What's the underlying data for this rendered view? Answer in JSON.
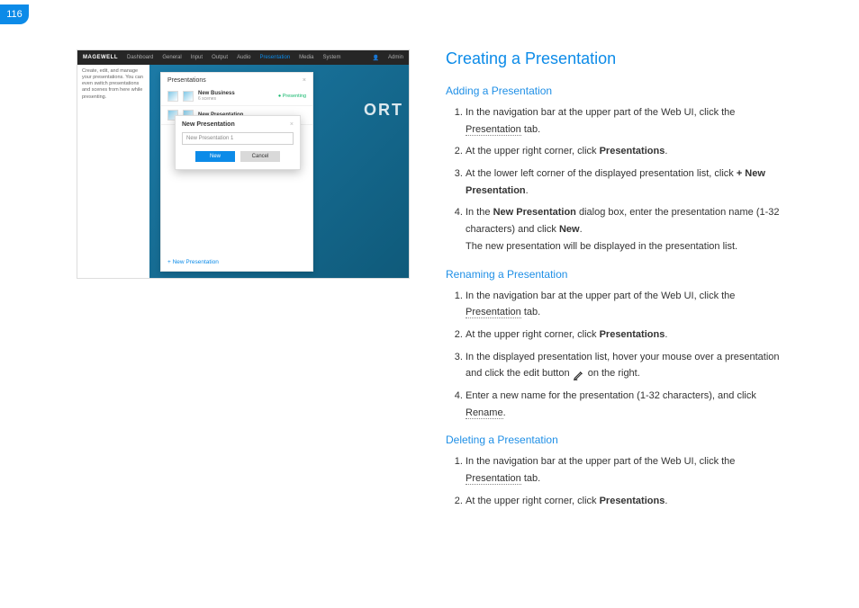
{
  "page_number": "116",
  "doc": {
    "title": "Creating a Presentation",
    "sections": [
      {
        "heading": "Adding a Presentation",
        "steps": [
          {
            "pre": "In the navigation bar at the upper part of the Web UI, click the ",
            "kw": "Presentation",
            "post": " tab."
          },
          {
            "pre": "At the upper right corner, click ",
            "bold": "Presentations",
            "post": "."
          },
          {
            "pre": "At the lower left corner of the displayed presentation list, click ",
            "bold": "+ New Presentation",
            "post": "."
          },
          {
            "pre": "In the ",
            "bold": "New Presentation",
            "mid": " dialog box, enter the presentation name (1-32 characters) and click ",
            "bold2": "New",
            "post": ".",
            "note": "The new presentation will be displayed in the presentation list."
          }
        ]
      },
      {
        "heading": "Renaming a Presentation",
        "steps": [
          {
            "pre": "In the navigation bar at the upper part of the Web UI, click the ",
            "kw": "Presentation",
            "post": " tab."
          },
          {
            "pre": "At the upper right corner, click ",
            "bold": "Presentations",
            "post": "."
          },
          {
            "pre": "In the displayed presentation list, hover your mouse over a presentation and click the edit button ",
            "icon": "pencil",
            "post": " on the right."
          },
          {
            "pre": "Enter a new name for the presentation (1-32 characters), and click ",
            "kw": "Rename",
            "post": "."
          }
        ]
      },
      {
        "heading": "Deleting a Presentation",
        "steps": [
          {
            "pre": "In the navigation bar at the upper part of the Web UI, click the ",
            "kw": "Presentation",
            "post": " tab."
          },
          {
            "pre": "At the upper right corner, click ",
            "bold": "Presentations",
            "post": "."
          }
        ]
      }
    ]
  },
  "shot": {
    "brand": "MAGEWELL",
    "nav": [
      "Dashboard",
      "General",
      "Input",
      "Output",
      "Audio",
      "Presentation",
      "Media",
      "System"
    ],
    "nav_active_index": 5,
    "admin": "Admin",
    "sidebar_text": "Create, edit, and manage your presentations. You can even switch presentations and scenes from here while presenting.",
    "panel_title": "Presentations",
    "rows": [
      {
        "name": "New Business",
        "sub": "6 scenes",
        "tag": "Presenting"
      },
      {
        "name": "New Presentation",
        "sub": ""
      }
    ],
    "footer": "+ New Presentation",
    "big": "ORT",
    "dialog": {
      "title": "New Presentation",
      "input": "New Presentation 1",
      "ok": "New",
      "cancel": "Cancel"
    }
  }
}
